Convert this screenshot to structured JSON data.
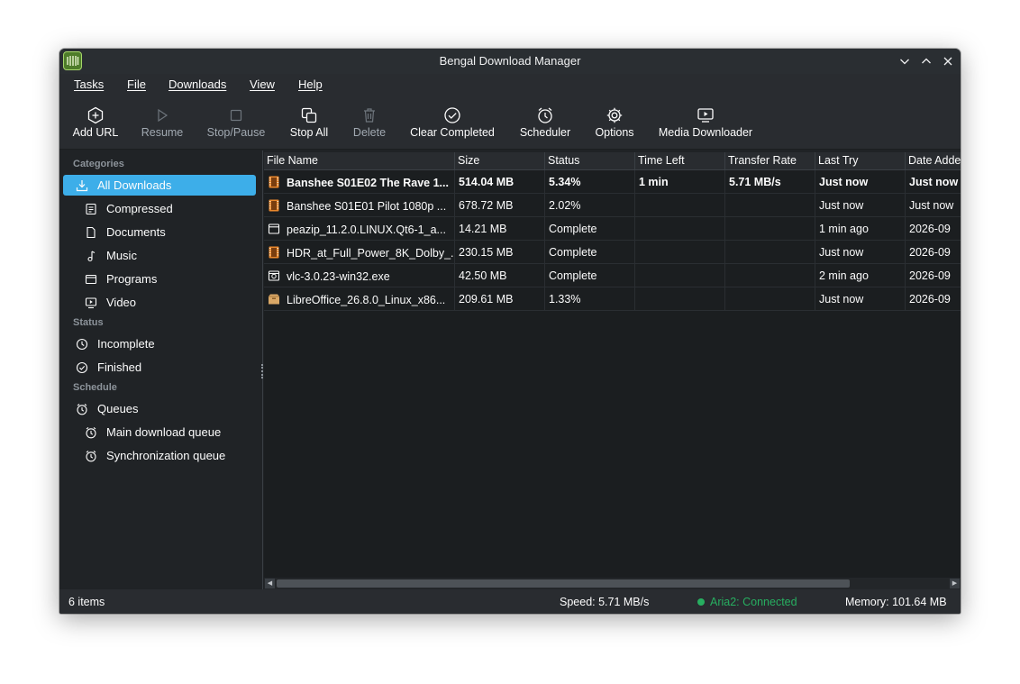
{
  "window": {
    "title": "Bengal Download Manager"
  },
  "menu": [
    "Tasks",
    "File",
    "Downloads",
    "View",
    "Help"
  ],
  "toolbar": {
    "add_url": "Add URL",
    "resume": "Resume",
    "stop_pause": "Stop/Pause",
    "stop_all": "Stop All",
    "delete": "Delete",
    "clear_completed": "Clear Completed",
    "scheduler": "Scheduler",
    "options": "Options",
    "media_downloader": "Media Downloader"
  },
  "sidebar": {
    "categories_header": "Categories",
    "categories": [
      "All Downloads",
      "Compressed",
      "Documents",
      "Music",
      "Programs",
      "Video"
    ],
    "status_header": "Status",
    "status": [
      "Incomplete",
      "Finished"
    ],
    "schedule_header": "Schedule",
    "queues": "Queues",
    "queue_items": [
      "Main download queue",
      "Synchronization queue"
    ]
  },
  "table": {
    "columns": [
      "File Name",
      "Size",
      "Status",
      "Time Left",
      "Transfer Rate",
      "Last Try",
      "Date Added"
    ],
    "rows": [
      {
        "name": "Banshee S01E02 The Rave 1...",
        "size": "514.04 MB",
        "status": "5.34%",
        "time_left": "1 min",
        "rate": "5.71  MB/s",
        "last_try": "Just now",
        "date_added": "Just now",
        "icon": "video-file-icon"
      },
      {
        "name": "Banshee S01E01 Pilot 1080p ...",
        "size": "678.72 MB",
        "status": "2.02%",
        "time_left": "",
        "rate": "",
        "last_try": "Just now",
        "date_added": "Just now",
        "icon": "video-file-icon"
      },
      {
        "name": "peazip_11.2.0.LINUX.Qt6-1_a...",
        "size": "14.21 MB",
        "status": "Complete",
        "time_left": "",
        "rate": "",
        "last_try": "1 min ago",
        "date_added": "2026-09",
        "icon": "package-file-icon"
      },
      {
        "name": "HDR_at_Full_Power_8K_Dolby_...",
        "size": "230.15 MB",
        "status": "Complete",
        "time_left": "",
        "rate": "",
        "last_try": "Just now",
        "date_added": "2026-09",
        "icon": "video-file-icon"
      },
      {
        "name": "vlc-3.0.23-win32.exe",
        "size": "42.50 MB",
        "status": "Complete",
        "time_left": "",
        "rate": "",
        "last_try": "2 min ago",
        "date_added": "2026-09",
        "icon": "executable-file-icon"
      },
      {
        "name": "LibreOffice_26.8.0_Linux_x86...",
        "size": "209.61 MB",
        "status": "1.33%",
        "time_left": "",
        "rate": "",
        "last_try": "Just now",
        "date_added": "2026-09",
        "icon": "archive-file-icon"
      }
    ]
  },
  "statusbar": {
    "items": "6 items",
    "speed": "Speed: 5.71 MB/s",
    "aria": "Aria2: Connected",
    "memory": "Memory: 101.64 MB"
  },
  "colors": {
    "accent": "#3daee9",
    "connected": "#27ae60",
    "background": "#202326"
  }
}
